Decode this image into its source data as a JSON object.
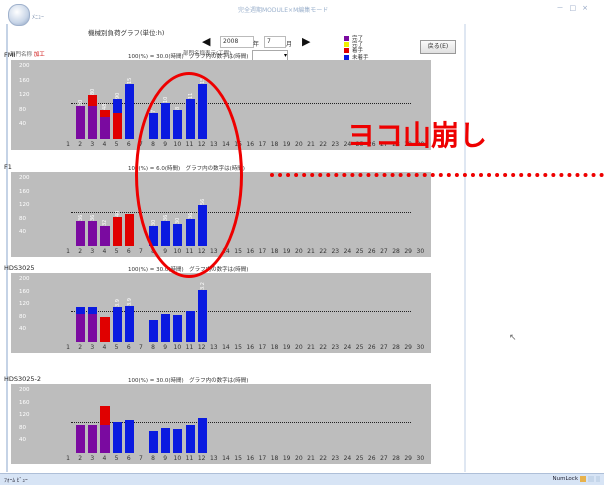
{
  "window": {
    "title": "完全週期MODULE×M編集モード",
    "office_menu": "ﾒﾆｭｰ",
    "controls": [
      "－",
      "□",
      "×"
    ]
  },
  "header": {
    "title": "機械別負荷グラフ(単位:h)",
    "year_value": "2008",
    "year_label": "年",
    "month_value": "7",
    "month_label": "月",
    "department_label": "部門名称",
    "department_value": "加工",
    "dept_display_label": "部門名称表示(工程)",
    "back_button": "戻る(E)",
    "legend": [
      {
        "label": "完了",
        "color": "#7a0aa0"
      },
      {
        "label": "完了",
        "color": "#f0f000"
      },
      {
        "label": "着手",
        "color": "#e00000"
      },
      {
        "label": "未着手",
        "color": "#0a1ae0"
      }
    ]
  },
  "annotation": {
    "text": "ヨコ山崩し"
  },
  "panels": [
    {
      "name": "FMI",
      "note": "100(%) = 30.0(時間)　グラフ内の数字は(時間)",
      "yticks": [
        "200",
        "160",
        "120",
        "80",
        "40"
      ],
      "threshold": 100,
      "chart_data": {
        "type": "bar",
        "categories": [
          "1",
          "2",
          "3",
          "4",
          "5",
          "6",
          "7",
          "8",
          "9",
          "10",
          "11",
          "12",
          "13",
          "14",
          "15",
          "16",
          "17",
          "18",
          "19",
          "20",
          "21",
          "22",
          "23",
          "24",
          "25",
          "26",
          "27",
          "28",
          "29",
          "30"
        ],
        "series": [
          {
            "name": "完了",
            "values": [
              0,
              90,
              90,
              60,
              0,
              0,
              0,
              0,
              0,
              0,
              0,
              0,
              0,
              0,
              0,
              0,
              0,
              0,
              0,
              0,
              0,
              0,
              0,
              0,
              0,
              0,
              0,
              0,
              0,
              0
            ]
          },
          {
            "name": "着手",
            "values": [
              0,
              0,
              30,
              20,
              70,
              0,
              0,
              0,
              0,
              0,
              0,
              0,
              0,
              0,
              0,
              0,
              0,
              0,
              0,
              0,
              0,
              0,
              0,
              0,
              0,
              0,
              0,
              0,
              0,
              0
            ]
          },
          {
            "name": "未着手",
            "values": [
              0,
              0,
              0,
              0,
              40,
              150,
              0,
              70,
              100,
              80,
              110,
              150,
              0,
              0,
              0,
              0,
              0,
              0,
              0,
              0,
              0,
              0,
              0,
              0,
              0,
              0,
              0,
              0,
              0,
              0
            ]
          }
        ],
        "ylim": [
          0,
          200
        ]
      },
      "data_labels": [
        "",
        "30",
        "80",
        "48",
        "90",
        "15",
        "",
        "7",
        "10",
        "8",
        "11",
        "15"
      ]
    },
    {
      "name": "F1",
      "note": "100(%) = 6.0(時間)　グラフ内の数字は(時間)",
      "yticks": [
        "200",
        "160",
        "120",
        "80",
        "40"
      ],
      "threshold": 100,
      "chart_data": {
        "type": "bar",
        "categories": [
          "1",
          "2",
          "3",
          "4",
          "5",
          "6",
          "7",
          "8",
          "9",
          "10",
          "11",
          "12",
          "13",
          "14",
          "15",
          "16",
          "17",
          "18",
          "19",
          "20",
          "21",
          "22",
          "23",
          "24",
          "25",
          "26",
          "27",
          "28",
          "29",
          "30"
        ],
        "series": [
          {
            "name": "完了",
            "values": [
              0,
              75,
              75,
              60,
              0,
              0,
              0,
              0,
              0,
              0,
              0,
              0,
              0,
              0,
              0,
              0,
              0,
              0,
              0,
              0,
              0,
              0,
              0,
              0,
              0,
              0,
              0,
              0,
              0,
              0
            ]
          },
          {
            "name": "着手",
            "values": [
              0,
              0,
              0,
              0,
              85,
              95,
              0,
              0,
              0,
              0,
              0,
              0,
              0,
              0,
              0,
              0,
              0,
              0,
              0,
              0,
              0,
              0,
              0,
              0,
              0,
              0,
              0,
              0,
              0,
              0
            ]
          },
          {
            "name": "未着手",
            "values": [
              0,
              0,
              0,
              0,
              0,
              0,
              0,
              60,
              75,
              65,
              80,
              120,
              0,
              0,
              0,
              0,
              0,
              0,
              0,
              0,
              0,
              0,
              0,
              0,
              0,
              0,
              0,
              0,
              0,
              0
            ]
          }
        ],
        "ylim": [
          0,
          200
        ]
      },
      "data_labels": [
        "",
        "36",
        "36",
        "32",
        "40",
        "",
        "",
        "30",
        "36",
        "30",
        "36",
        "56"
      ]
    },
    {
      "name": "HDS3025",
      "note": "100(%) = 30.0(時間)　グラフ内の数字は(時間)",
      "yticks": [
        "200",
        "160",
        "120",
        "80",
        "40"
      ],
      "threshold": 100,
      "chart_data": {
        "type": "bar",
        "categories": [
          "1",
          "2",
          "3",
          "4",
          "5",
          "6",
          "7",
          "8",
          "9",
          "10",
          "11",
          "12",
          "13",
          "14",
          "15",
          "16",
          "17",
          "18",
          "19",
          "20",
          "21",
          "22",
          "23",
          "24",
          "25",
          "26",
          "27",
          "28",
          "29",
          "30"
        ],
        "series": [
          {
            "name": "完了",
            "values": [
              0,
              90,
              90,
              0,
              0,
              0,
              0,
              0,
              0,
              0,
              0,
              0,
              0,
              0,
              0,
              0,
              0,
              0,
              0,
              0,
              0,
              0,
              0,
              0,
              0,
              0,
              0,
              0,
              0,
              0
            ]
          },
          {
            "name": "着手",
            "values": [
              0,
              0,
              0,
              80,
              0,
              0,
              0,
              0,
              0,
              0,
              0,
              0,
              0,
              0,
              0,
              0,
              0,
              0,
              0,
              0,
              0,
              0,
              0,
              0,
              0,
              0,
              0,
              0,
              0,
              0
            ]
          },
          {
            "name": "未着手",
            "values": [
              0,
              20,
              20,
              0,
              110,
              115,
              0,
              70,
              90,
              85,
              100,
              165,
              0,
              0,
              0,
              0,
              0,
              0,
              0,
              0,
              0,
              0,
              0,
              0,
              0,
              0,
              0,
              0,
              0,
              0
            ]
          }
        ],
        "ylim": [
          0,
          200
        ]
      },
      "data_labels": [
        "",
        "",
        "",
        "",
        "3.9",
        "3.9",
        "",
        "",
        "",
        "",
        "",
        "3.2"
      ]
    },
    {
      "name": "HDS3025-2",
      "note": "100(%) = 30.0(時間)　グラフ内の数字は(時間)",
      "yticks": [
        "200",
        "160",
        "120",
        "80",
        "40"
      ],
      "threshold": 100,
      "chart_data": {
        "type": "bar",
        "categories": [
          "1",
          "2",
          "3",
          "4",
          "5",
          "6",
          "7",
          "8",
          "9",
          "10",
          "11",
          "12",
          "13",
          "14",
          "15",
          "16",
          "17",
          "18",
          "19",
          "20",
          "21",
          "22",
          "23",
          "24",
          "25",
          "26",
          "27",
          "28",
          "29",
          "30"
        ],
        "series": [
          {
            "name": "完了",
            "values": [
              0,
              90,
              90,
              90,
              0,
              0,
              0,
              0,
              0,
              0,
              0,
              0,
              0,
              0,
              0,
              0,
              0,
              0,
              0,
              0,
              0,
              0,
              0,
              0,
              0,
              0,
              0,
              0,
              0,
              0
            ]
          },
          {
            "name": "着手",
            "values": [
              0,
              0,
              0,
              60,
              0,
              0,
              0,
              0,
              0,
              0,
              0,
              0,
              0,
              0,
              0,
              0,
              0,
              0,
              0,
              0,
              0,
              0,
              0,
              0,
              0,
              0,
              0,
              0,
              0,
              0
            ]
          },
          {
            "name": "未着手",
            "values": [
              0,
              0,
              0,
              0,
              100,
              105,
              0,
              70,
              80,
              75,
              90,
              110,
              0,
              0,
              0,
              0,
              0,
              0,
              0,
              0,
              0,
              0,
              0,
              0,
              0,
              0,
              0,
              0,
              0,
              0
            ]
          }
        ],
        "ylim": [
          0,
          200
        ]
      },
      "data_labels": []
    }
  ],
  "status": {
    "left": "ﾌｫｰﾑ ﾋﾞｭｰ",
    "right": "NumLock"
  }
}
